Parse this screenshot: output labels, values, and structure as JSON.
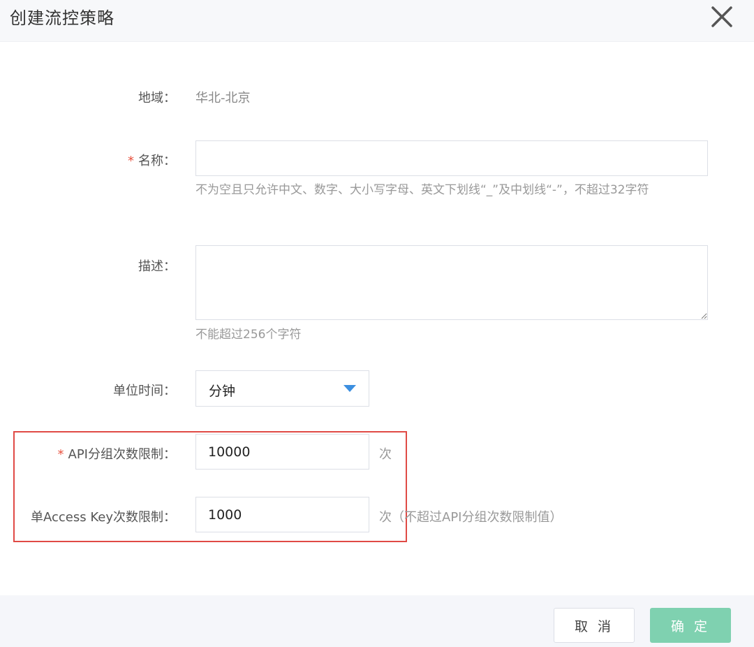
{
  "dialog": {
    "title": "创建流控策略"
  },
  "form": {
    "region": {
      "label": "地域：",
      "value": "华北-北京"
    },
    "name": {
      "label": "名称：",
      "required_mark": "*",
      "value": "",
      "placeholder": "",
      "hint": "不为空且只允许中文、数字、大小写字母、英文下划线“_”及中划线“-”，不超过32字符"
    },
    "description": {
      "label": "描述：",
      "value": "",
      "placeholder": "",
      "hint": "不能超过256个字符"
    },
    "unit_time": {
      "label": "单位时间：",
      "selected": "分钟"
    },
    "api_group_limit": {
      "label": "API分组次数限制：",
      "required_mark": "*",
      "value": "10000",
      "unit": "次"
    },
    "access_key_limit": {
      "label": "单Access Key次数限制：",
      "value": "1000",
      "unit": "次（不超过API分组次数限制值）"
    }
  },
  "footer": {
    "cancel_label": "取 消",
    "confirm_label": "确 定"
  },
  "colors": {
    "required": "#e8523f",
    "highlight_border": "#e04a45",
    "select_caret": "#3c8fe0",
    "confirm_button": "#7fd1b0"
  },
  "icons": {
    "close": "close-icon",
    "dropdown": "caret-down-icon"
  }
}
